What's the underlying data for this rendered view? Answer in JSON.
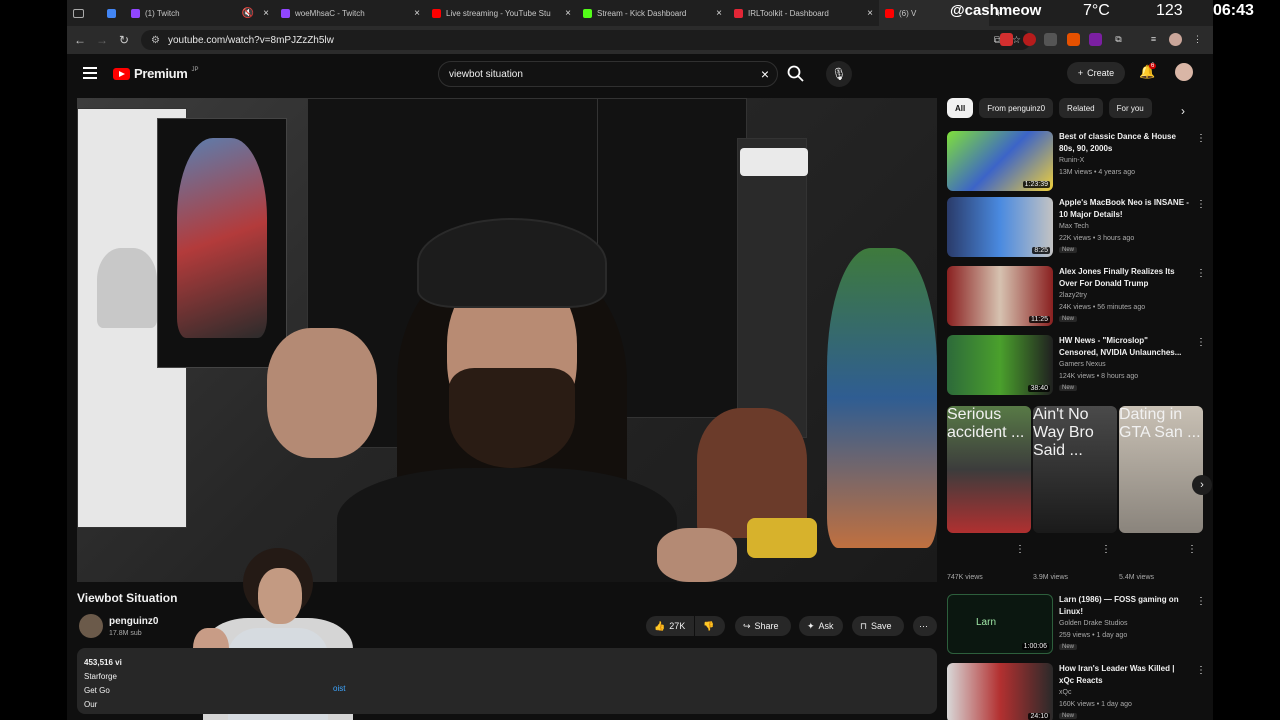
{
  "browser": {
    "tabs": [
      {
        "label": "",
        "color": "#4285f4"
      },
      {
        "label": "(1) Twitch",
        "color": "#9146ff"
      },
      {
        "label": "woeMhsaC - Twitch",
        "color": "#9146ff"
      },
      {
        "label": "Live streaming - YouTube Stu",
        "color": "#ff0000"
      },
      {
        "label": "Stream - Kick Dashboard",
        "color": "#53fc18"
      },
      {
        "label": "IRLToolkit - Dashboard",
        "color": "#e32636"
      },
      {
        "label": "(6) V",
        "color": "#ff0000"
      }
    ],
    "url": "youtube.com/watch?v=8mPJZzZh5lw"
  },
  "overlay": {
    "handle": "@cashmeow",
    "temperature": "7°C",
    "number": "123",
    "time": "06:43"
  },
  "header": {
    "logo_text": "Premium",
    "logo_region": "JP",
    "search_value": "viewbot situation",
    "create_label": "Create",
    "notification_count": "6"
  },
  "video": {
    "title": "Viewbot Situation",
    "channel": "penguinz0",
    "subscribers": "17.8M sub",
    "likes": "27K",
    "share_label": "Share",
    "ask_label": "Ask",
    "save_label": "Save",
    "desc_views": "453,516 vi",
    "desc_line2": "Starforge",
    "desc_line3": "Get Go",
    "desc_line4": "Our",
    "desc_link": "oist"
  },
  "chips": [
    "All",
    "From penguinz0",
    "Related",
    "For you"
  ],
  "recommendations": [
    {
      "title": "Best of classic Dance & House 80s, 90, 2000s",
      "channel": "Runin-X",
      "meta": "13M views • 4 years ago",
      "duration": "1:23:39",
      "new": "",
      "thumb": "#4fb23a"
    },
    {
      "title": "Apple's MacBook Neo is INSANE - 10 Major Details!",
      "channel": "Max Tech",
      "meta": "22K views • 3 hours ago",
      "duration": "8:25",
      "new": "New",
      "thumb": "#3d6fd8"
    },
    {
      "title": "Alex Jones Finally Realizes Its Over For Donald Trump",
      "channel": "2lazy2try",
      "meta": "24K views • 56 minutes ago",
      "duration": "11:25",
      "new": "New",
      "thumb": "#b83b3b"
    },
    {
      "title": "HW News - \"Microslop\" Censored, NVIDIA Unlaunches...",
      "channel": "Gamers Nexus",
      "meta": "124K views • 8 hours ago",
      "duration": "38:40",
      "new": "New",
      "thumb": "#2e7a3e"
    },
    {
      "title": "Larn (1986) — FOSS gaming on Linux!",
      "channel": "Golden Drake Studios",
      "meta": "259 views • 1 day ago",
      "duration": "1:00:06",
      "new": "New",
      "thumb": "#0c1a12"
    },
    {
      "title": "How Iran's Leader Was Killed | xQc Reacts",
      "channel": "xQc",
      "meta": "160K views • 1 day ago",
      "duration": "24:10",
      "new": "New",
      "thumb": "#c8c8c8"
    }
  ],
  "shorts": [
    {
      "title": "Serious accident ...",
      "views": "747K views",
      "thumb": "#5f7a4c"
    },
    {
      "title": "Ain't No Way Bro Said ...",
      "views": "3.9M views",
      "thumb": "#6b6b6b"
    },
    {
      "title": "Dating in GTA San ...",
      "views": "5.4M views",
      "thumb": "#b9b2a4"
    }
  ]
}
